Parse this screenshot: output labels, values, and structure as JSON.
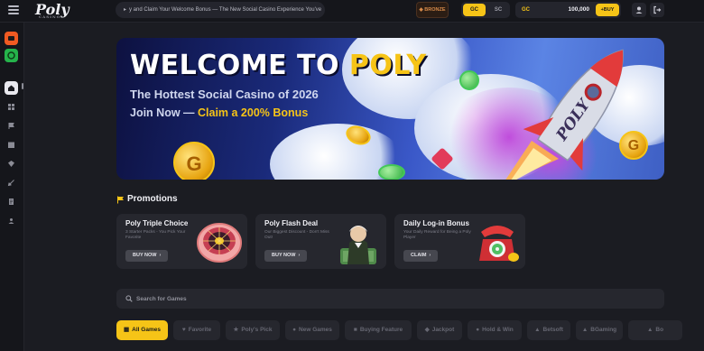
{
  "header": {
    "logo": "Poly",
    "logo_tagline": "CASINO",
    "ticker": "y and Claim Your Welcome Bonus — The New Social Casino Experience You've",
    "tier": "BRONZE",
    "currency_options": [
      "GC",
      "SC"
    ],
    "balance_currency": "GC",
    "balance_value": "100,000",
    "buy_label": "+BUY"
  },
  "hero": {
    "title_white": "WELCOME TO ",
    "title_accent": "POLY",
    "subtitle": "The Hottest Social Casino of 2026",
    "cta_white": "Join Now — ",
    "cta_accent": "Claim a 200% Bonus",
    "rocket_text": "POLY",
    "coin_letter": "G"
  },
  "promotions": {
    "heading": "Promotions",
    "cards": [
      {
        "title": "Poly Triple Choice",
        "desc": "3 Starter Packs - You Pick Your Favorite",
        "button": "BUY NOW"
      },
      {
        "title": "Poly Flash Deal",
        "desc": "Our Biggest Discount - Don't Miss Out!",
        "button": "BUY NOW"
      },
      {
        "title": "Daily Log-in Bonus",
        "desc": "Your Daily Reward for Being a Poly Player",
        "button": "CLAIM"
      }
    ]
  },
  "search": {
    "placeholder": "Search for Games"
  },
  "categories": [
    "All Games",
    "Favorite",
    "Poly's Pick",
    "New Games",
    "Buying Feature",
    "Jackpot",
    "Hold & Win",
    "Betsoft",
    "BGaming",
    "Bo"
  ],
  "colors": {
    "accent": "#f6c417",
    "background": "#1b1c22",
    "panel": "#26272e",
    "tier": "#d88b4a"
  }
}
